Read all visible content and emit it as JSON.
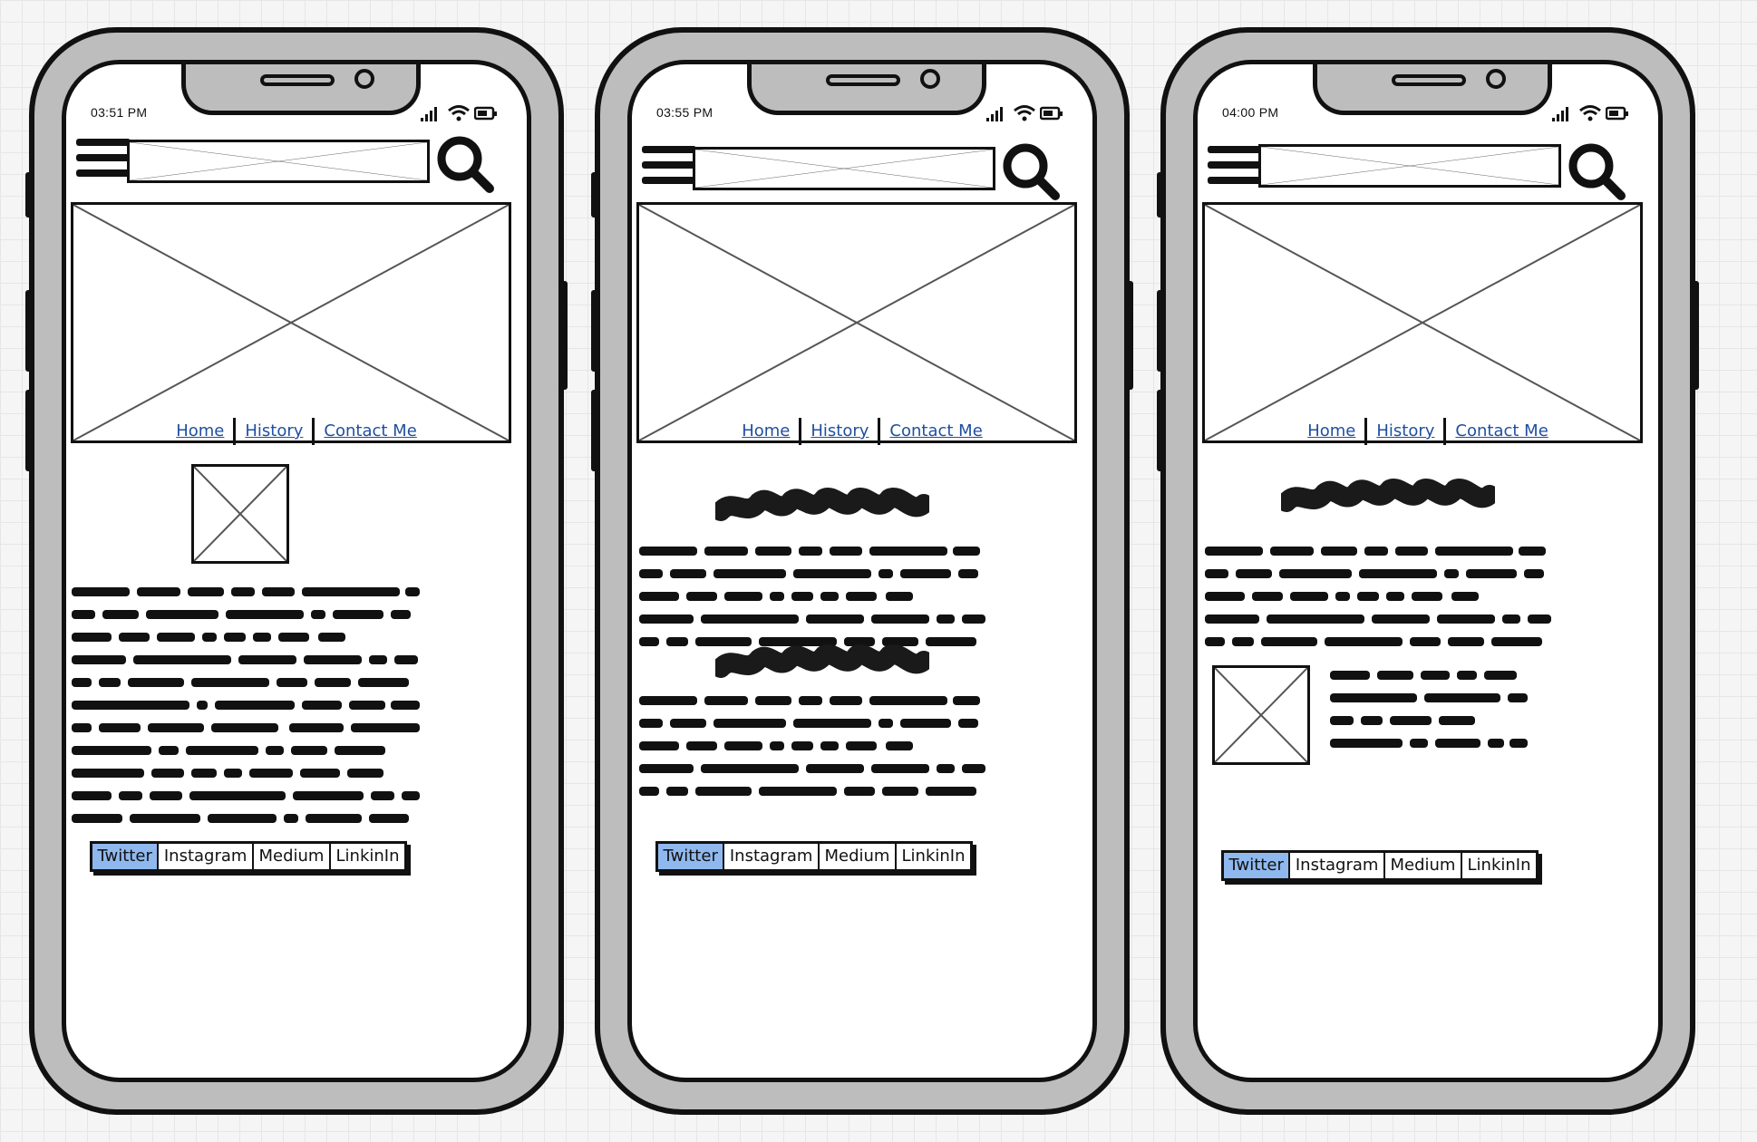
{
  "phones": [
    {
      "time": "03:51 PM",
      "nav": [
        "Home",
        "History",
        "Contact Me"
      ],
      "social": [
        "Twitter",
        "Instagram",
        "Medium",
        "LinkinIn"
      ],
      "active_social": "Twitter"
    },
    {
      "time": "03:55 PM",
      "nav": [
        "Home",
        "History",
        "Contact Me"
      ],
      "social": [
        "Twitter",
        "Instagram",
        "Medium",
        "LinkinIn"
      ],
      "active_social": "Twitter"
    },
    {
      "time": "04:00 PM",
      "nav": [
        "Home",
        "History",
        "Contact Me"
      ],
      "social": [
        "Twitter",
        "Instagram",
        "Medium",
        "LinkinIn"
      ],
      "active_social": "Twitter"
    }
  ],
  "colors": {
    "link": "#1f4f9e",
    "active_tab": "#8fb8ee",
    "frame": "#bdbdbd",
    "ink": "#111111"
  },
  "icons": [
    "menu-icon",
    "search-icon",
    "signal-icon",
    "wifi-icon",
    "battery-icon",
    "image-placeholder-icon"
  ]
}
